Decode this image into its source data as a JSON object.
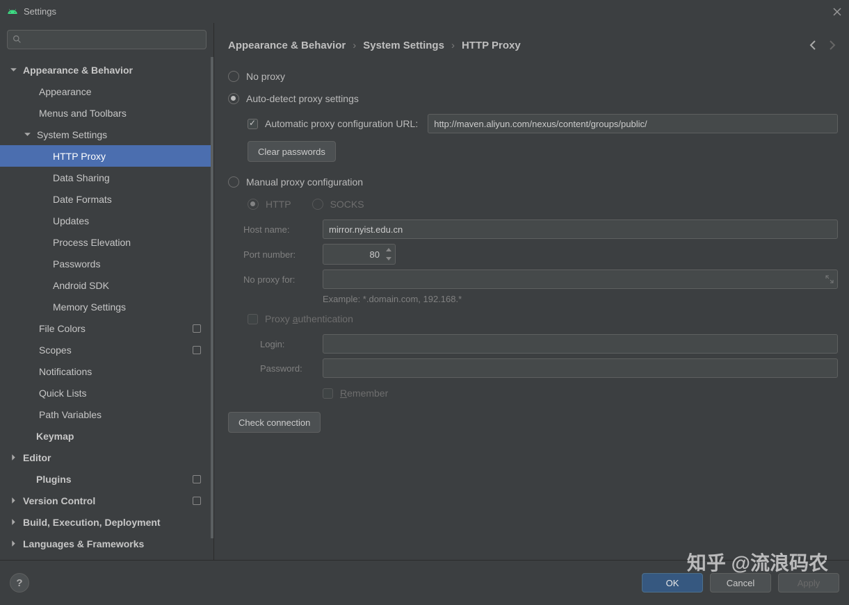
{
  "window": {
    "title": "Settings"
  },
  "search": {
    "placeholder": ""
  },
  "sidebar": {
    "items": [
      {
        "label": "Appearance & Behavior",
        "bold": true,
        "chevron": "down",
        "lvl": 0
      },
      {
        "label": "Appearance",
        "lvl": 1
      },
      {
        "label": "Menus and Toolbars",
        "lvl": 1
      },
      {
        "label": "System Settings",
        "lvl": 1,
        "chevron": "down"
      },
      {
        "label": "HTTP Proxy",
        "lvl": 2,
        "selected": true
      },
      {
        "label": "Data Sharing",
        "lvl": 2
      },
      {
        "label": "Date Formats",
        "lvl": 2
      },
      {
        "label": "Updates",
        "lvl": 2
      },
      {
        "label": "Process Elevation",
        "lvl": 2
      },
      {
        "label": "Passwords",
        "lvl": 2
      },
      {
        "label": "Android SDK",
        "lvl": 2
      },
      {
        "label": "Memory Settings",
        "lvl": 2
      },
      {
        "label": "File Colors",
        "lvl": 1,
        "badge": true
      },
      {
        "label": "Scopes",
        "lvl": 1,
        "badge": true
      },
      {
        "label": "Notifications",
        "lvl": 1
      },
      {
        "label": "Quick Lists",
        "lvl": 1
      },
      {
        "label": "Path Variables",
        "lvl": 1
      },
      {
        "label": "Keymap",
        "bold": true,
        "lvl": 0,
        "nochev": true
      },
      {
        "label": "Editor",
        "bold": true,
        "chevron": "right",
        "lvl": 0
      },
      {
        "label": "Plugins",
        "bold": true,
        "lvl": 0,
        "badge": true,
        "nochev": true
      },
      {
        "label": "Version Control",
        "bold": true,
        "chevron": "right",
        "lvl": 0,
        "badge": true
      },
      {
        "label": "Build, Execution, Deployment",
        "bold": true,
        "chevron": "right",
        "lvl": 0
      },
      {
        "label": "Languages & Frameworks",
        "bold": true,
        "chevron": "right",
        "lvl": 0
      }
    ]
  },
  "breadcrumb": {
    "a": "Appearance & Behavior",
    "b": "System Settings",
    "c": "HTTP Proxy"
  },
  "proxy": {
    "no_proxy": "No proxy",
    "auto_detect": "Auto-detect proxy settings",
    "auto_url_label": "Automatic proxy configuration URL:",
    "auto_url_value": "http://maven.aliyun.com/nexus/content/groups/public/",
    "clear_passwords": "Clear passwords",
    "manual": "Manual proxy configuration",
    "http": "HTTP",
    "socks": "SOCKS",
    "host_label": "Host name:",
    "host_value": "mirror.nyist.edu.cn",
    "port_label": "Port number:",
    "port_value": "80",
    "noproxy_label": "No proxy for:",
    "noproxy_value": "",
    "example": "Example: *.domain.com, 192.168.*",
    "proxy_auth": "Proxy authentication",
    "login_label": "Login:",
    "login_value": "",
    "password_label": "Password:",
    "password_value": "",
    "remember": "Remember",
    "check_connection": "Check connection"
  },
  "footer": {
    "ok": "OK",
    "cancel": "Cancel",
    "apply": "Apply"
  },
  "watermark": "知乎 @流浪码农"
}
